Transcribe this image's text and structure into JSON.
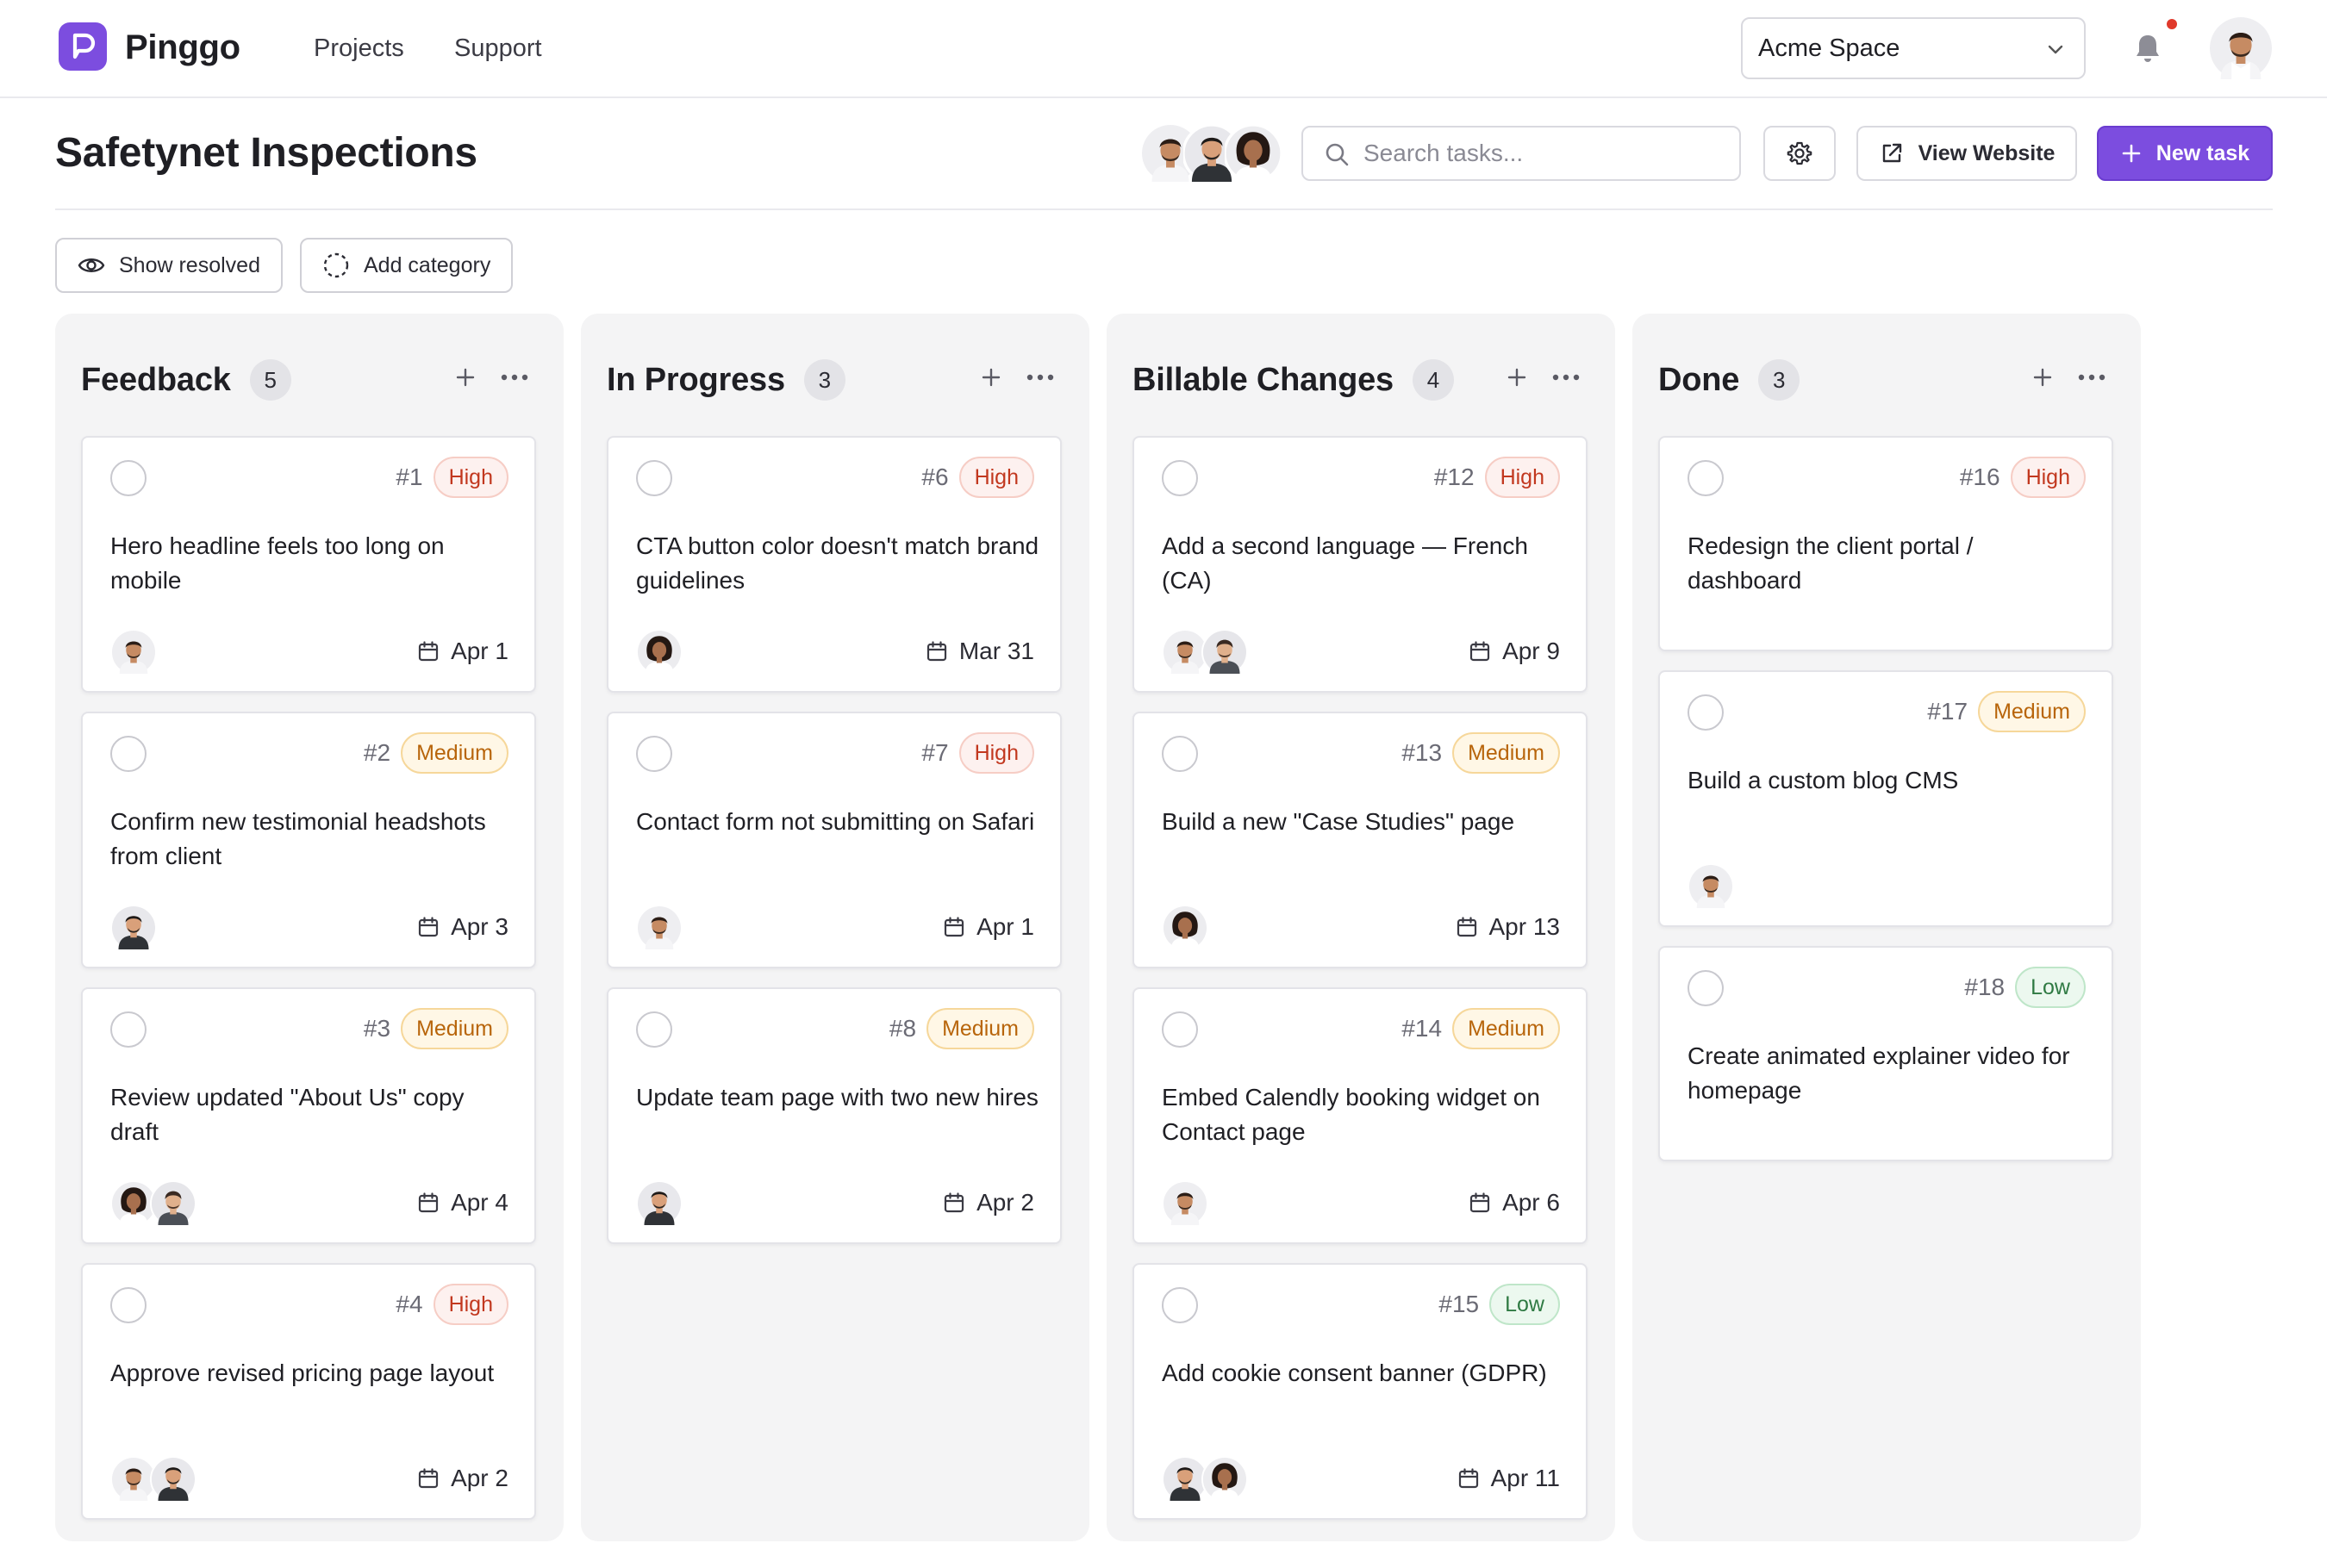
{
  "app": {
    "brand": "Pinggo"
  },
  "nav": {
    "links": [
      "Projects",
      "Support"
    ]
  },
  "workspace": {
    "name": "Acme Space"
  },
  "page": {
    "title": "Safetynet Inspections"
  },
  "search": {
    "placeholder": "Search tasks..."
  },
  "toolbar": {
    "view_website": "View Website",
    "new_task": "New task"
  },
  "filters": {
    "show_resolved": "Show resolved",
    "add_category": "Add category"
  },
  "colors": {
    "accent": "#7c4ddf",
    "high": "#c2381f",
    "medium": "#b8650b",
    "low": "#2f7a43"
  },
  "columns": [
    {
      "title": "Feedback",
      "count": "5",
      "cards": [
        {
          "num": "#1",
          "priority": "High",
          "title": "Hero headline feels too long on mobile",
          "people": [
            "man-b"
          ],
          "due": "Apr 1"
        },
        {
          "num": "#2",
          "priority": "Medium",
          "title": "Confirm new testimonial headshots from client",
          "people": [
            "man-a"
          ],
          "due": "Apr 3"
        },
        {
          "num": "#3",
          "priority": "Medium",
          "title": "Review updated \"About Us\" copy draft",
          "people": [
            "woman",
            "man-c"
          ],
          "due": "Apr 4"
        },
        {
          "num": "#4",
          "priority": "High",
          "title": "Approve revised pricing page layout",
          "people": [
            "man-b",
            "man-a"
          ],
          "due": "Apr 2"
        }
      ]
    },
    {
      "title": "In Progress",
      "count": "3",
      "cards": [
        {
          "num": "#6",
          "priority": "High",
          "title": "CTA button color doesn't match brand guidelines",
          "people": [
            "woman"
          ],
          "due": "Mar 31"
        },
        {
          "num": "#7",
          "priority": "High",
          "title": "Contact form not submitting on Safari",
          "people": [
            "man-b"
          ],
          "due": "Apr 1"
        },
        {
          "num": "#8",
          "priority": "Medium",
          "title": "Update team page with two new hires",
          "people": [
            "man-a"
          ],
          "due": "Apr 2"
        }
      ]
    },
    {
      "title": "Billable Changes",
      "count": "4",
      "cards": [
        {
          "num": "#12",
          "priority": "High",
          "title": "Add a second language — French (CA)",
          "people": [
            "man-b",
            "man-c"
          ],
          "due": "Apr 9"
        },
        {
          "num": "#13",
          "priority": "Medium",
          "title": "Build a new \"Case Studies\" page",
          "people": [
            "woman"
          ],
          "due": "Apr 13"
        },
        {
          "num": "#14",
          "priority": "Medium",
          "title": "Embed Calendly booking widget on Contact page",
          "people": [
            "man-b"
          ],
          "due": "Apr 6"
        },
        {
          "num": "#15",
          "priority": "Low",
          "title": "Add cookie consent banner (GDPR)",
          "people": [
            "man-a",
            "woman"
          ],
          "due": "Apr 11"
        }
      ]
    },
    {
      "title": "Done",
      "count": "3",
      "cards": [
        {
          "num": "#16",
          "priority": "High",
          "title": "Redesign the client portal / dashboard",
          "people": [],
          "due": ""
        },
        {
          "num": "#17",
          "priority": "Medium",
          "title": "Build a custom blog CMS",
          "people": [
            "man-b"
          ],
          "due": ""
        },
        {
          "num": "#18",
          "priority": "Low",
          "title": "Create animated explainer video for homepage",
          "people": [],
          "due": ""
        }
      ]
    }
  ]
}
